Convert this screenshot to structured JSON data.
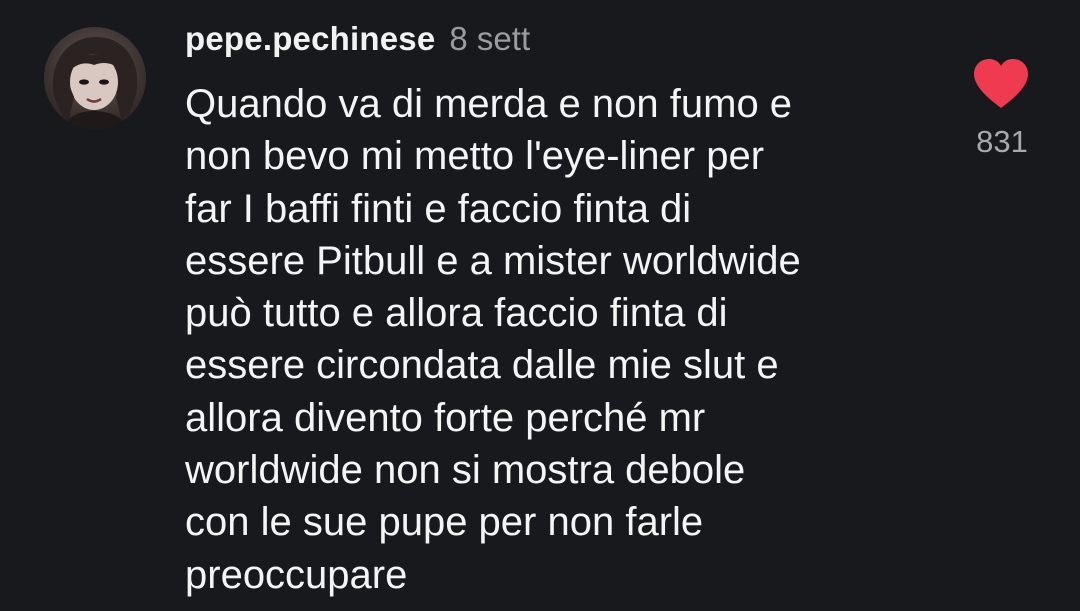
{
  "comment": {
    "username": "pepe.pechinese",
    "timestamp": "8 sett",
    "lines": [
      "Quando va di merda e non fumo e",
      "non bevo mi metto l'eye-liner per",
      "far I baffi finti e faccio finta di",
      "essere Pitbull e a mister worldwide",
      "può tutto e allora faccio finta di",
      "essere circondata dalle mie slut e",
      "allora divento forte perché mr",
      "worldwide non si mostra debole",
      "con le sue pupe per non farle",
      "preoccupare"
    ],
    "likes": "831",
    "liked": true
  },
  "icons": {
    "avatar": "profile-photo",
    "like": "heart-icon"
  },
  "colors": {
    "background": "#17191c",
    "heart": "#f03a4f",
    "primary_text": "#f4f4f4",
    "secondary_text": "#9a9ca0"
  }
}
